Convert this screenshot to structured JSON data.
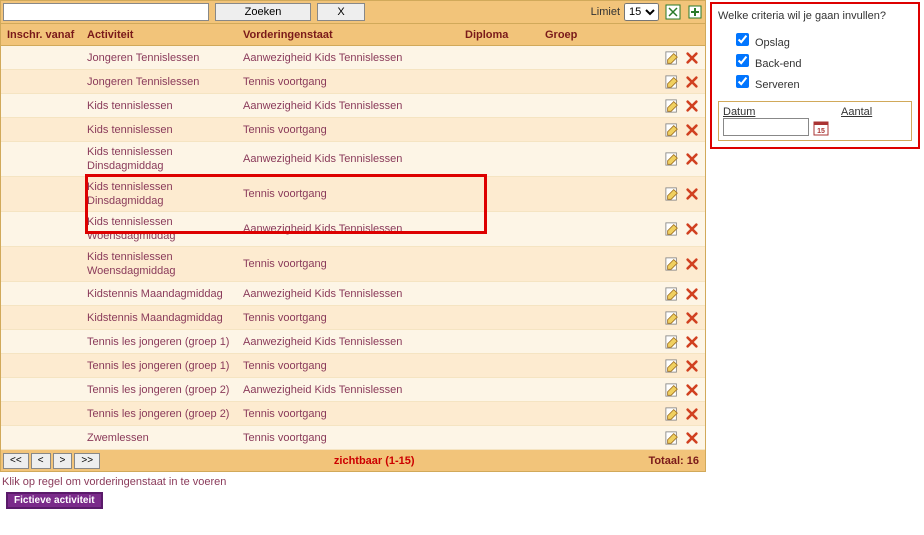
{
  "toolbar": {
    "search_value": "",
    "zoeken_label": "Zoeken",
    "x_label": "X",
    "limiet_label": "Limiet",
    "limiet_value": "15"
  },
  "headers": {
    "inschr": "Inschr. vanaf",
    "activiteit": "Activiteit",
    "vorderingenstaat": "Vorderingenstaat",
    "diploma": "Diploma",
    "groep": "Groep"
  },
  "rows": [
    {
      "inschr": "",
      "activiteit": "Jongeren Tennislessen",
      "vorderingenstaat": "Aanwezigheid Kids Tennislessen",
      "diploma": "",
      "groep": ""
    },
    {
      "inschr": "",
      "activiteit": "Jongeren Tennislessen",
      "vorderingenstaat": "Tennis voortgang",
      "diploma": "",
      "groep": ""
    },
    {
      "inschr": "",
      "activiteit": "Kids tennislessen",
      "vorderingenstaat": "Aanwezigheid Kids Tennislessen",
      "diploma": "",
      "groep": ""
    },
    {
      "inschr": "",
      "activiteit": "Kids tennislessen",
      "vorderingenstaat": "Tennis voortgang",
      "diploma": "",
      "groep": ""
    },
    {
      "inschr": "",
      "activiteit": "Kids tennislessen Dinsdagmiddag",
      "vorderingenstaat": "Aanwezigheid Kids Tennislessen",
      "diploma": "",
      "groep": ""
    },
    {
      "inschr": "",
      "activiteit": "Kids tennislessen Dinsdagmiddag",
      "vorderingenstaat": "Tennis voortgang",
      "diploma": "",
      "groep": ""
    },
    {
      "inschr": "",
      "activiteit": "Kids tennislessen Woensdagmiddag",
      "vorderingenstaat": "Aanwezigheid Kids Tennislessen",
      "diploma": "",
      "groep": ""
    },
    {
      "inschr": "",
      "activiteit": "Kids tennislessen Woensdagmiddag",
      "vorderingenstaat": "Tennis voortgang",
      "diploma": "",
      "groep": ""
    },
    {
      "inschr": "",
      "activiteit": "Kidstennis Maandagmiddag",
      "vorderingenstaat": "Aanwezigheid Kids Tennislessen",
      "diploma": "",
      "groep": ""
    },
    {
      "inschr": "",
      "activiteit": "Kidstennis Maandagmiddag",
      "vorderingenstaat": "Tennis voortgang",
      "diploma": "",
      "groep": ""
    },
    {
      "inschr": "",
      "activiteit": "Tennis les jongeren (groep 1)",
      "vorderingenstaat": "Aanwezigheid Kids Tennislessen",
      "diploma": "",
      "groep": ""
    },
    {
      "inschr": "",
      "activiteit": "Tennis les jongeren (groep 1)",
      "vorderingenstaat": "Tennis voortgang",
      "diploma": "",
      "groep": ""
    },
    {
      "inschr": "",
      "activiteit": "Tennis les jongeren (groep 2)",
      "vorderingenstaat": "Aanwezigheid Kids Tennislessen",
      "diploma": "",
      "groep": ""
    },
    {
      "inschr": "",
      "activiteit": "Tennis les jongeren (groep 2)",
      "vorderingenstaat": "Tennis voortgang",
      "diploma": "",
      "groep": ""
    },
    {
      "inschr": "",
      "activiteit": "Zwemlessen",
      "vorderingenstaat": "Tennis voortgang",
      "diploma": "",
      "groep": ""
    }
  ],
  "footer": {
    "pager": {
      "first": "<<",
      "prev": "<",
      "next": ">",
      "last": ">>"
    },
    "visible": "zichtbaar (1-15)",
    "totaal_label": "Totaal:",
    "totaal_value": "16"
  },
  "bottom_text": "Klik op regel om vorderingenstaat in te voeren",
  "fictieve_label": "Fictieve activiteit",
  "side": {
    "title": "Welke criteria wil je gaan invullen?",
    "criteria": [
      {
        "label": "Opslag",
        "checked": true
      },
      {
        "label": "Back-end",
        "checked": true
      },
      {
        "label": "Serveren",
        "checked": true
      }
    ],
    "datum_label": "Datum",
    "aantal_label": "Aantal",
    "datum_value": ""
  },
  "icons": {
    "export": "export-excel-icon",
    "add": "add-icon",
    "edit": "edit-icon",
    "delete": "delete-icon",
    "calendar": "calendar-icon"
  }
}
